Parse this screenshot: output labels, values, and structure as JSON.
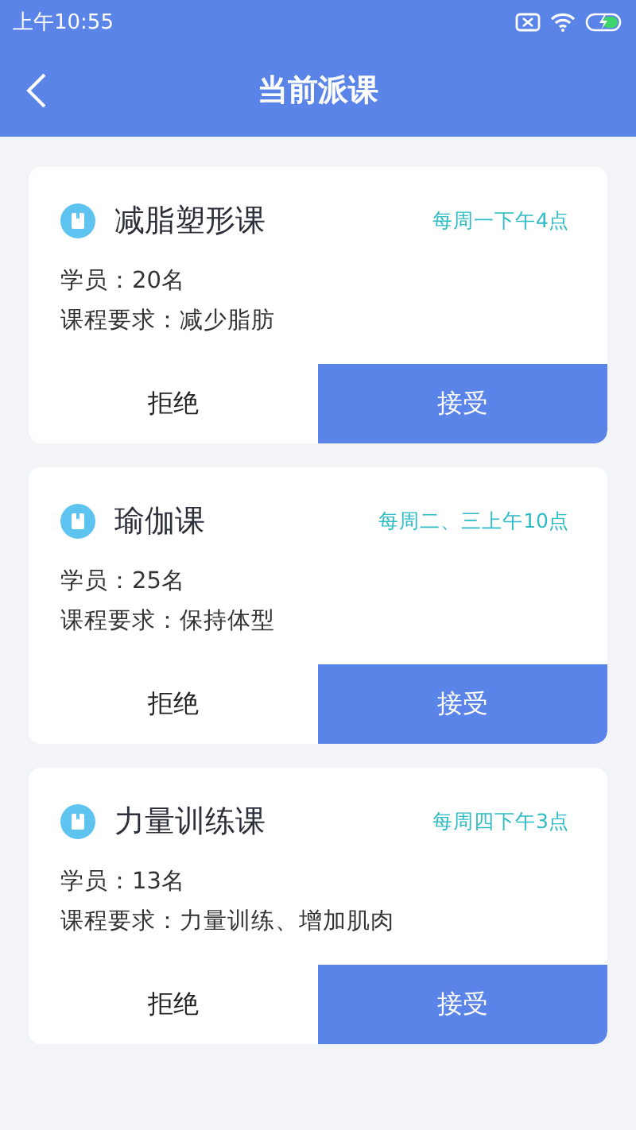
{
  "status_bar": {
    "time": "上午10:55"
  },
  "header": {
    "title": "当前派课"
  },
  "courses": [
    {
      "title": "减脂塑形课",
      "schedule": "每周一下午4点",
      "students": "学员：20名",
      "requirement": "课程要求：减少脂肪",
      "actions": [
        {
          "label": "拒绝",
          "kind": "reject"
        },
        {
          "label": "接受",
          "kind": "accept"
        }
      ]
    },
    {
      "title": "瑜伽课",
      "schedule": "每周二、三上午10点",
      "students": "学员：25名",
      "requirement": "课程要求：保持体型",
      "actions": [
        {
          "label": "拒绝",
          "kind": "reject"
        },
        {
          "label": "接受",
          "kind": "accept"
        }
      ]
    },
    {
      "title": "力量训练课",
      "schedule": "每周四下午3点",
      "students": "学员：13名",
      "requirement": "课程要求：力量训练、增加肌肉",
      "actions": [
        {
          "label": "拒绝",
          "kind": "reject"
        },
        {
          "label": "接受",
          "kind": "accept"
        }
      ]
    }
  ]
}
